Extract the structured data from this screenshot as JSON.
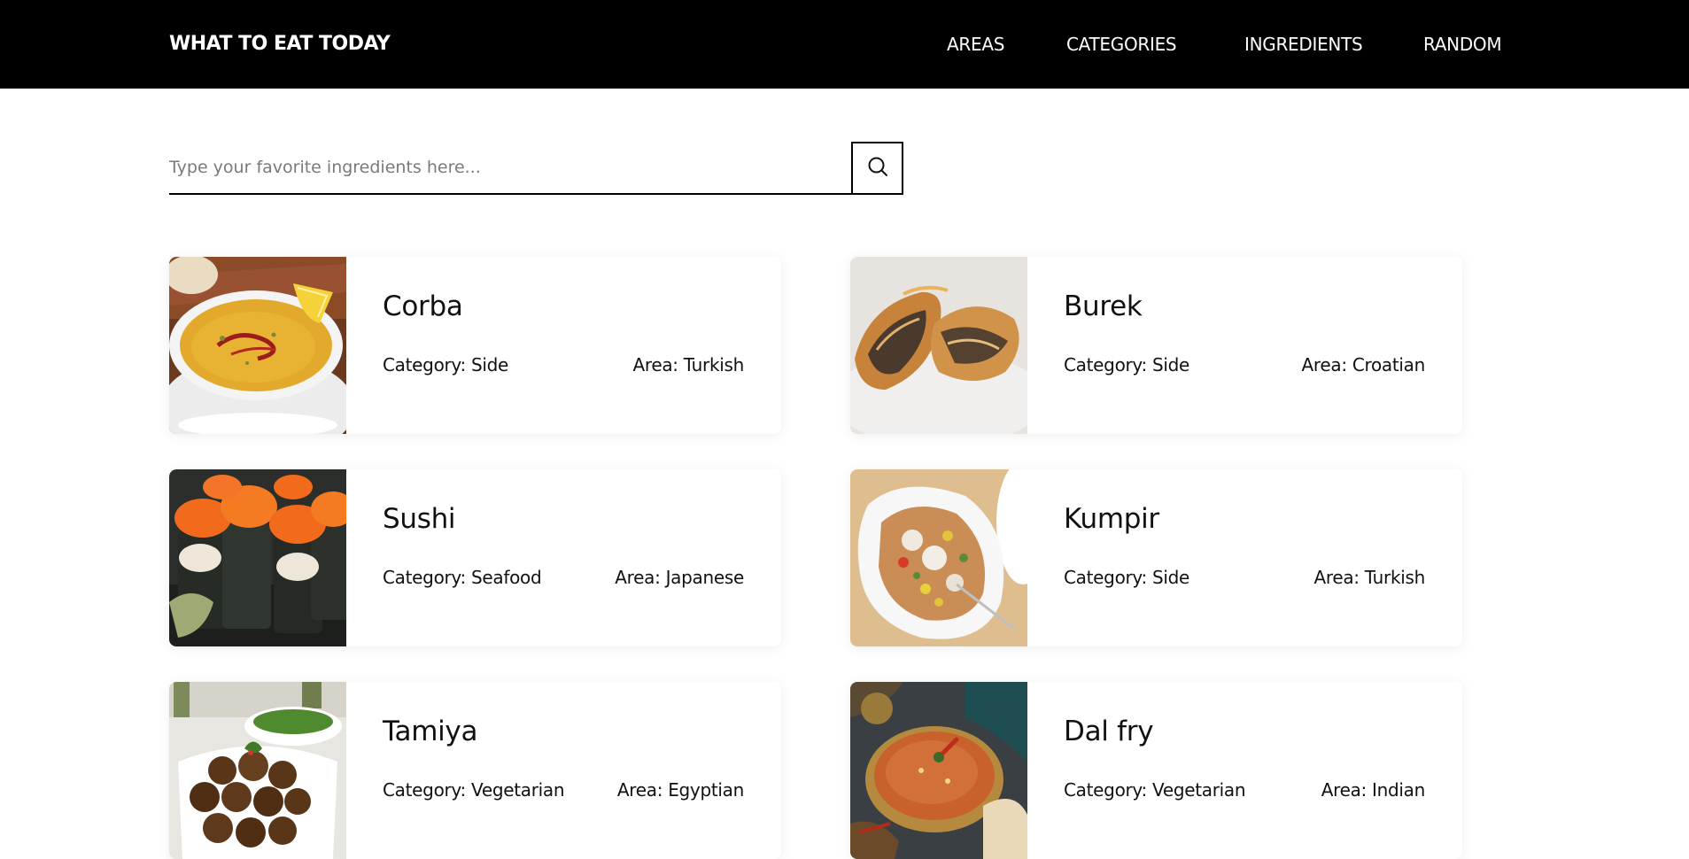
{
  "nav": {
    "brand": "WHAT TO EAT TODAY",
    "links": [
      "AREAS",
      "CATEGORIES",
      "INGREDIENTS",
      "RANDOM"
    ]
  },
  "search": {
    "placeholder": "Type your favorite ingredients here...",
    "value": "",
    "button_icon": "search-icon"
  },
  "meals": [
    {
      "name": "Corba",
      "category": "Category: Side",
      "area": "Area: Turkish",
      "image": "lentil-soup-bowl-photo"
    },
    {
      "name": "Burek",
      "category": "Category: Side",
      "area": "Area: Croatian",
      "image": "meat-pastry-photo"
    },
    {
      "name": "Sushi",
      "category": "Category: Seafood",
      "area": "Area: Japanese",
      "image": "sushi-rolls-photo"
    },
    {
      "name": "Kumpir",
      "category": "Category: Side",
      "area": "Area: Turkish",
      "image": "stuffed-potato-photo"
    },
    {
      "name": "Tamiya",
      "category": "Category: Vegetarian",
      "area": "Area: Egyptian",
      "image": "falafel-plate-photo"
    },
    {
      "name": "Dal fry",
      "category": "Category: Vegetarian",
      "area": "Area: Indian",
      "image": "dal-curry-bowl-photo"
    }
  ],
  "colors": {
    "navbar_bg": "#000000",
    "navbar_text": "#ffffff",
    "page_bg": "#ffffff",
    "text": "#111111",
    "placeholder": "#7a7a7a"
  }
}
